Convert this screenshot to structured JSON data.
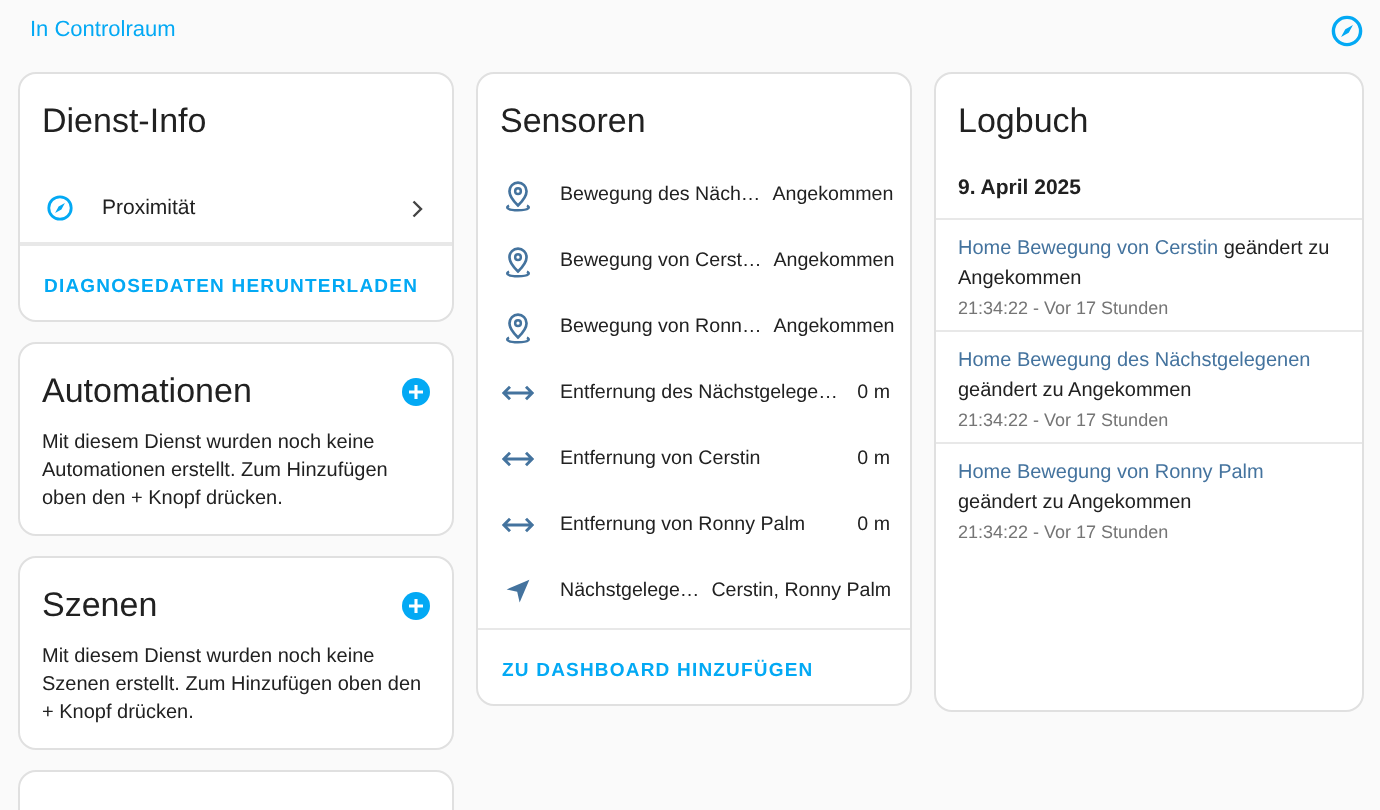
{
  "header": {
    "breadcrumb": "In Controlraum"
  },
  "service_info": {
    "title": "Dienst-Info",
    "items": [
      {
        "label": "Proximität"
      }
    ],
    "action": "DIAGNOSEDATEN HERUNTERLADEN"
  },
  "automations": {
    "title": "Automationen",
    "text": "Mit diesem Dienst wurden noch keine Automationen erstellt. Zum Hinzufügen oben den + Knopf drücken."
  },
  "scenes": {
    "title": "Szenen",
    "text": "Mit diesem Dienst wurden noch keine Szenen erstellt. Zum Hinzufügen oben den + Knopf drücken."
  },
  "sensors": {
    "title": "Sensoren",
    "rows": [
      {
        "kind": "location",
        "name": "Bewegung des Näch…",
        "state": "Angekommen"
      },
      {
        "kind": "location",
        "name": "Bewegung von Cerst…",
        "state": "Angekommen"
      },
      {
        "kind": "location",
        "name": "Bewegung von Ronn…",
        "state": "Angekommen"
      },
      {
        "kind": "distance",
        "name": "Entfernung des Nächstgelege…",
        "state": "0 m"
      },
      {
        "kind": "distance",
        "name": "Entfernung von Cerstin",
        "state": "0 m"
      },
      {
        "kind": "distance",
        "name": "Entfernung von Ronny Palm",
        "state": "0 m"
      },
      {
        "kind": "navigation",
        "name": "Nächstgelege…",
        "state": "Cerstin, Ronny Palm"
      }
    ],
    "action": "ZU DASHBOARD HINZUFÜGEN"
  },
  "logbook": {
    "title": "Logbuch",
    "date": "9. April 2025",
    "entries": [
      {
        "entity": "Home Bewegung von Cerstin",
        "message": "geändert zu Angekommen",
        "time": "21:34:22 - Vor 17 Stunden"
      },
      {
        "entity": "Home Bewegung des Nächstgelegenen",
        "message": "geändert zu Angekommen",
        "time": "21:34:22 - Vor 17 Stunden"
      },
      {
        "entity": "Home Bewegung von Ronny Palm",
        "message": "geändert zu Angekommen",
        "time": "21:34:22 - Vor 17 Stunden"
      }
    ]
  }
}
